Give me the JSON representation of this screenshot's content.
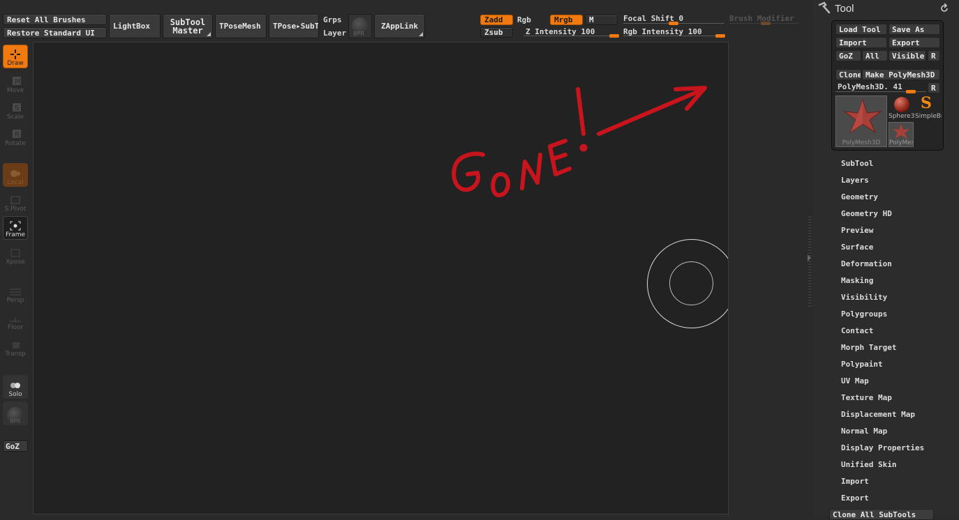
{
  "top": {
    "reset_brushes": "Reset All Brushes",
    "restore_ui": "Restore Standard UI",
    "lightbox": "LightBox",
    "subtool_master_1": "SubTool",
    "subtool_master_2": "Master",
    "tposemesh": "TPoseMesh",
    "tpose_subt": "TPose▸SubT",
    "grps": "Grps",
    "layer": "Layer",
    "bpr": "BPR",
    "zapplink": "ZAppLink",
    "zadd": "Zadd",
    "zsub": "Zsub",
    "rgb": "Rgb",
    "mrgb": "Mrgb",
    "m": "M",
    "z_intensity": "Z Intensity 100",
    "focal_shift": "Focal Shift 0",
    "rgb_intensity": "Rgb Intensity 100",
    "brush_modifier": "Brush Modifier"
  },
  "left_toolbar": {
    "draw": "Draw",
    "move": "Move",
    "scale": "Scale",
    "rotate": "Rotate",
    "local": "Local",
    "spivot": "S.Pivot",
    "frame": "Frame",
    "xpose": "Xpose",
    "persp": "Persp",
    "floor": "Floor",
    "transp": "Transp",
    "solo": "Solo",
    "bpr": "BPR",
    "goz": "GoZ"
  },
  "annotation": {
    "text": "GoNE!"
  },
  "tool_panel": {
    "title": "Tool",
    "load_tool": "Load Tool",
    "save_as": "Save As",
    "import": "Import",
    "export": "Export",
    "goz": "GoZ",
    "all": "All",
    "visible": "Visible",
    "r": "R",
    "clone": "Clone",
    "make_polymesh": "Make PolyMesh3D",
    "current_tool": "PolyMesh3D. 41",
    "thumb_main": "PolyMesh3D",
    "thumb_sphere": "Sphere3",
    "thumb_simple": "SimpleBr",
    "thumb_poly": "PolyMes"
  },
  "menu_items": [
    "SubTool",
    "Layers",
    "Geometry",
    "Geometry HD",
    "Preview",
    "Surface",
    "Deformation",
    "Masking",
    "Visibility",
    "Polygroups",
    "Contact",
    "Morph Target",
    "Polypaint",
    "UV Map",
    "Texture Map",
    "Displacement Map",
    "Normal Map",
    "Display Properties",
    "Unified Skin",
    "Import",
    "Export"
  ],
  "bottom_button": "Clone All SubTools",
  "colors": {
    "accent": "#f07a10",
    "annotation_red": "#c8141c",
    "background": "#2a2a2a",
    "canvas": "#222222"
  }
}
